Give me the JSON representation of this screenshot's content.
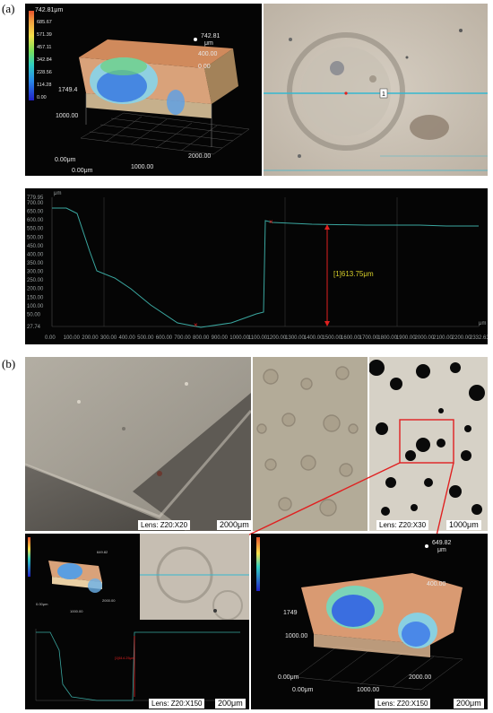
{
  "labels": {
    "a": "(a)",
    "b": "(b)"
  },
  "colorbar_a": {
    "unit": "742.81μm",
    "ticks": [
      "685.67",
      "571.39",
      "457.11",
      "342.84",
      "228.56",
      "114.28",
      "0.00"
    ]
  },
  "surface_a": {
    "z_top": "742.81",
    "z_unit": "μm",
    "z_mid": "400.00",
    "z_zero": "0.00",
    "y_edge": "1749.4",
    "y_mid": "1000.00",
    "origin_z": "0.00μm",
    "origin_x": "0.00μm",
    "x_mid": "1000.00",
    "x_end": "2000.00"
  },
  "micro_a": {
    "marker": "1"
  },
  "profile_a": {
    "y_max": "779.95",
    "y_unit": "μm",
    "y_ticks": [
      "700.00",
      "650.00",
      "600.00",
      "550.00",
      "500.00",
      "450.00",
      "400.00",
      "350.00",
      "300.00",
      "250.00",
      "200.00",
      "150.00",
      "100.00",
      "50.00"
    ],
    "y_min": "27.74",
    "x_ticks": [
      "0.00",
      "100.00",
      "200.00",
      "300.00",
      "400.00",
      "500.00",
      "600.00",
      "700.00",
      "800.00",
      "900.00",
      "1000.00",
      "1100.00",
      "1200.00",
      "1300.00",
      "1400.00",
      "1500.00",
      "1600.00",
      "1700.00",
      "1800.00",
      "1900.00",
      "2000.00",
      "2100.00",
      "2200.00"
    ],
    "x_end": "2332.63",
    "x_unit": "μm",
    "measure": "[1]613.75μm"
  },
  "photos_b": {
    "p1_lens": "Lens: Z20:X20",
    "p1_scale": "2000μm",
    "p3_lens": "Lens: Z20:X30",
    "p3_scale": "1000μm"
  },
  "small_surface_b": {
    "z_top": "649.82",
    "origin": "0.00μm",
    "x_mid": "1000.00",
    "x_end": "2000.00"
  },
  "small_profile_b": {
    "measure": "[1]614.25μm"
  },
  "bottom_b": {
    "lens": "Lens: Z20:X150",
    "scale": "200μm"
  },
  "large_surface_b": {
    "z_top": "649.82",
    "z_unit": "μm",
    "z_mid": "400.00",
    "y_edge": "1749",
    "y_mid": "1000.00",
    "origin_z": "0.00μm",
    "origin_x": "0.00μm",
    "x_mid": "1000.00",
    "x_end": "2000.00",
    "lens": "Lens: Z20:X150",
    "scale": "200μm"
  },
  "colors": {
    "profile_line": "#3aa7a0",
    "measure": "#e0201e",
    "panel_bg": "#050505",
    "measure_text": "#d7cf2a"
  }
}
